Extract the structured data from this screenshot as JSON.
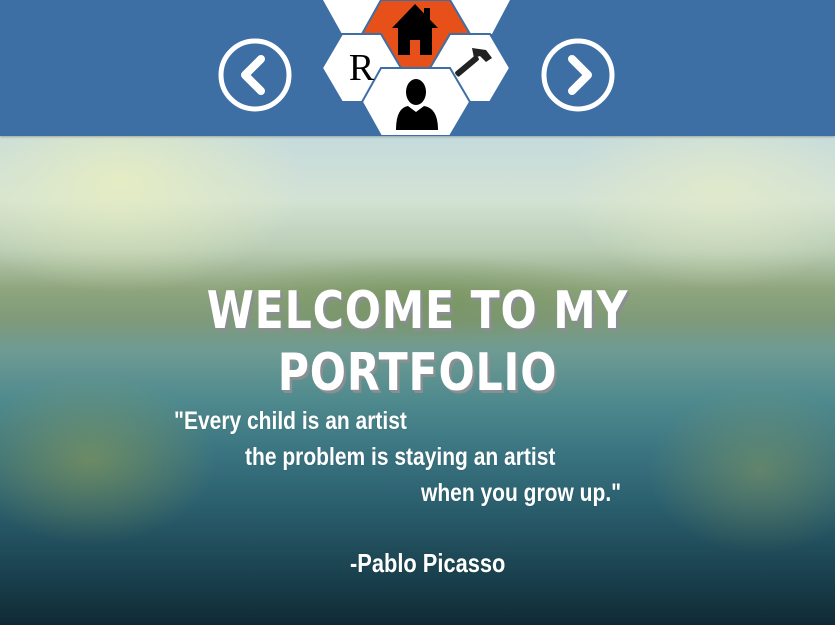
{
  "header": {
    "prev_icon": "chevron-left-circle-icon",
    "next_icon": "chevron-right-circle-icon",
    "nav_hexes": [
      {
        "name": "home",
        "icon": "home-icon",
        "color": "#e8501a"
      },
      {
        "name": "resume",
        "label": "R",
        "color": "#ffffff"
      },
      {
        "name": "tools",
        "icon": "hammer-icon",
        "color": "#ffffff"
      },
      {
        "name": "about",
        "icon": "person-icon",
        "color": "#ffffff"
      }
    ],
    "bar_color": "#3d6fa5"
  },
  "hero": {
    "title": "WELCOME TO MY PORTFOLIO",
    "quote_lines": [
      "\"Every child is an artist",
      "the problem is staying an artist",
      "when you grow up.\""
    ],
    "author": "-Pablo Picasso"
  }
}
